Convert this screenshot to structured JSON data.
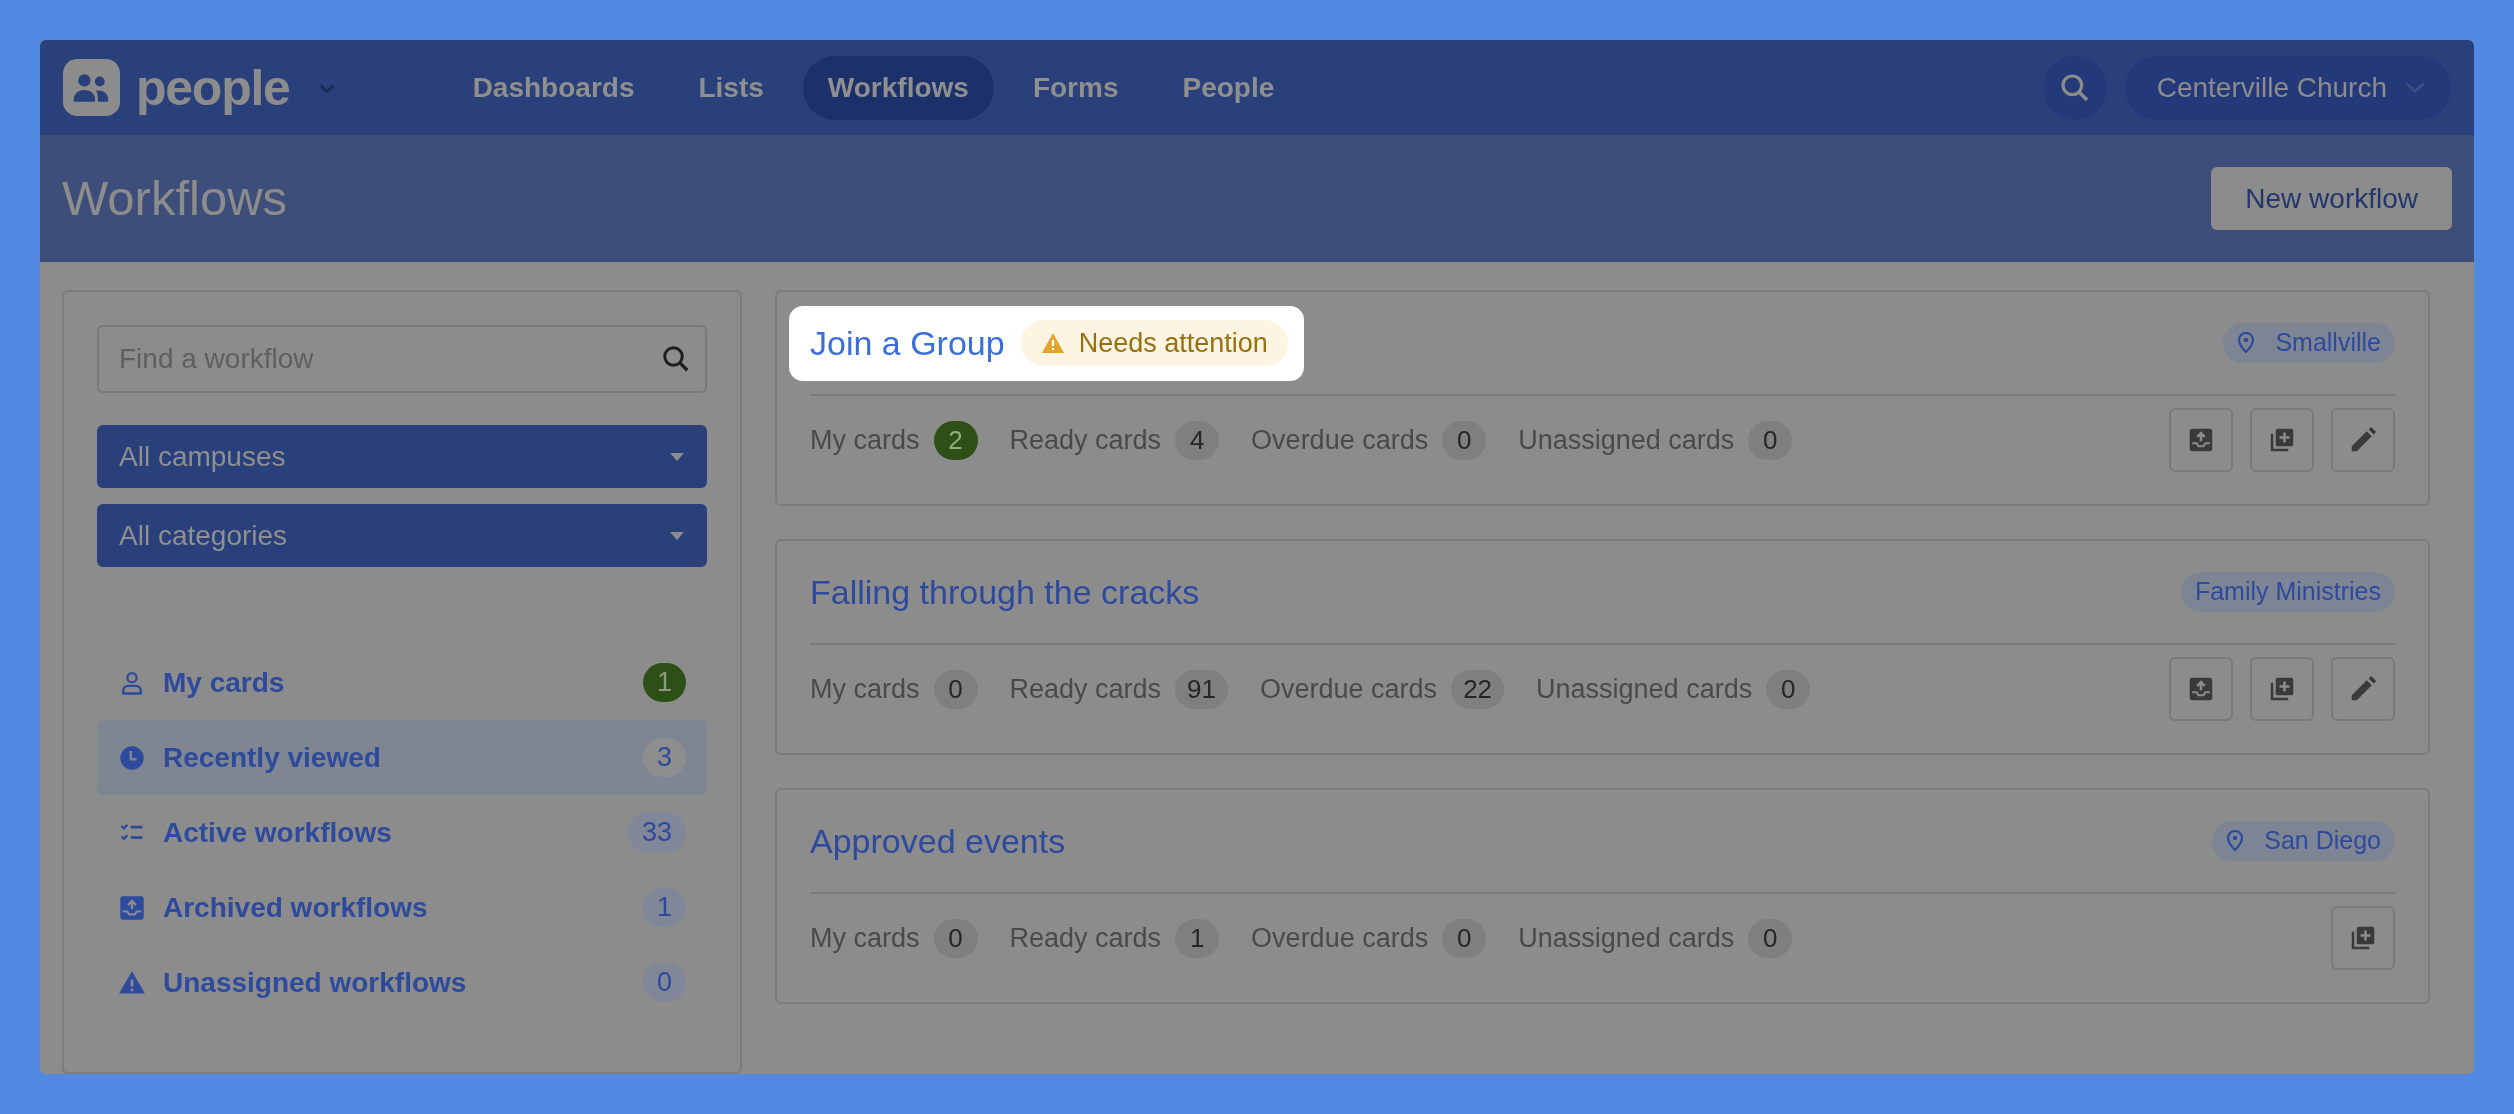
{
  "app": {
    "logo": "people",
    "nav": [
      {
        "label": "Dashboards",
        "selected": false
      },
      {
        "label": "Lists",
        "selected": false
      },
      {
        "label": "Workflows",
        "selected": true
      },
      {
        "label": "Forms",
        "selected": false
      },
      {
        "label": "People",
        "selected": false
      }
    ],
    "organization": "Centerville Church"
  },
  "header": {
    "title": "Workflows",
    "button": "New workflow"
  },
  "sidebar": {
    "search": {
      "placeholder": "Find a workflow"
    },
    "filters": [
      "All campuses",
      "All categories"
    ],
    "items": [
      {
        "kind": "person",
        "label": "My cards",
        "count": "1",
        "emphasis": true,
        "selected": false
      },
      {
        "kind": "clock",
        "label": "Recently viewed",
        "count": "3",
        "emphasis": false,
        "selected": true
      },
      {
        "kind": "checklist",
        "label": "Active workflows",
        "count": "33",
        "emphasis": false,
        "selected": false
      },
      {
        "kind": "archive",
        "label": "Archived workflows",
        "count": "1",
        "emphasis": false,
        "selected": false
      },
      {
        "kind": "warning",
        "label": "Unassigned workflows",
        "count": "0",
        "emphasis": false,
        "selected": false
      }
    ]
  },
  "workflows": [
    {
      "title": "Join a Group",
      "highlighted": true,
      "badge": "Needs attention",
      "tag": {
        "kind": "campus",
        "text": "Smallville"
      },
      "stats": [
        {
          "label": "My cards",
          "count": "2",
          "emphasis": true
        },
        {
          "label": "Ready cards",
          "count": "4",
          "emphasis": false
        },
        {
          "label": "Overdue cards",
          "count": "0",
          "emphasis": false
        },
        {
          "label": "Unassigned cards",
          "count": "0",
          "emphasis": false
        }
      ],
      "actions": [
        {
          "kind": "archive"
        },
        {
          "kind": "duplicate"
        },
        {
          "kind": "edit"
        }
      ]
    },
    {
      "title": "Falling through the cracks",
      "highlighted": false,
      "tag": {
        "kind": "category",
        "text": "Family Ministries"
      },
      "stats": [
        {
          "label": "My cards",
          "count": "0",
          "emphasis": false
        },
        {
          "label": "Ready cards",
          "count": "91",
          "emphasis": false
        },
        {
          "label": "Overdue cards",
          "count": "22",
          "emphasis": false
        },
        {
          "label": "Unassigned cards",
          "count": "0",
          "emphasis": false
        }
      ],
      "actions": [
        {
          "kind": "archive"
        },
        {
          "kind": "duplicate"
        },
        {
          "kind": "edit"
        }
      ]
    },
    {
      "title": "Approved events",
      "highlighted": false,
      "tag": {
        "kind": "campus",
        "text": "San Diego"
      },
      "stats": [
        {
          "label": "My cards",
          "count": "0",
          "emphasis": false
        },
        {
          "label": "Ready cards",
          "count": "1",
          "emphasis": false
        },
        {
          "label": "Overdue cards",
          "count": "0",
          "emphasis": false
        },
        {
          "label": "Unassigned cards",
          "count": "0",
          "emphasis": false
        }
      ],
      "actions": [
        {
          "kind": "duplicate"
        }
      ]
    }
  ]
}
